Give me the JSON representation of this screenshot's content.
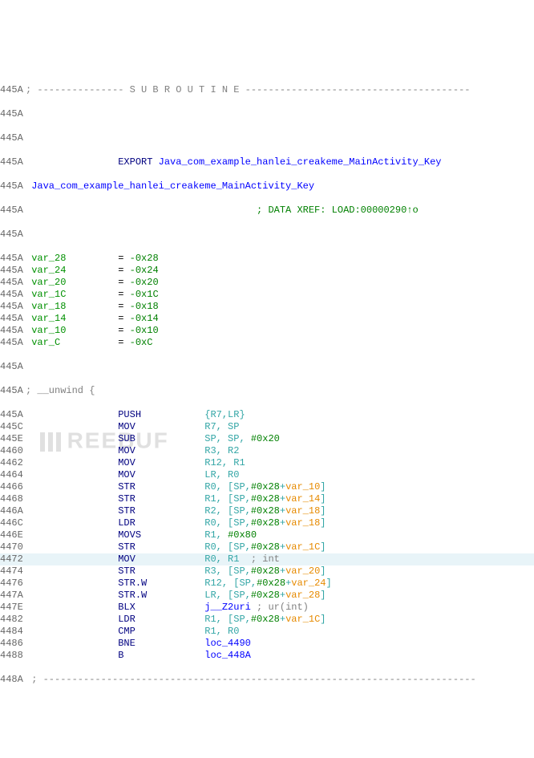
{
  "header": {
    "subroutine_banner": "; --------------- S U B R O U T I N E ---------------------------------------"
  },
  "export": {
    "keyword": "EXPORT",
    "symbol": "Java_com_example_hanlei_creakeme_MainActivity_Key"
  },
  "label": "Java_com_example_hanlei_creakeme_MainActivity_Key",
  "xref_comment": "; DATA XREF: LOAD:00000290↑o",
  "vars": [
    {
      "name": "var_28",
      "eq": "= ",
      "val": "-0x28"
    },
    {
      "name": "var_24",
      "eq": "= ",
      "val": "-0x24"
    },
    {
      "name": "var_20",
      "eq": "= ",
      "val": "-0x20"
    },
    {
      "name": "var_1C",
      "eq": "= ",
      "val": "-0x1C"
    },
    {
      "name": "var_18",
      "eq": "= ",
      "val": "-0x18"
    },
    {
      "name": "var_14",
      "eq": "= ",
      "val": "-0x14"
    },
    {
      "name": "var_10",
      "eq": "= ",
      "val": "-0x10"
    },
    {
      "name": "var_C",
      "eq": "= ",
      "val": "-0xC"
    }
  ],
  "unwind_comment": "; __unwind {",
  "instructions": [
    {
      "addr": "445A",
      "mnem": "PUSH",
      "ops": [
        {
          "t": "{R7,LR}",
          "c": "darkcyan"
        }
      ]
    },
    {
      "addr": "445C",
      "mnem": "MOV",
      "ops": [
        {
          "t": "R7, SP",
          "c": "darkcyan"
        }
      ]
    },
    {
      "addr": "445E",
      "mnem": "SUB",
      "ops": [
        {
          "t": "SP, SP, ",
          "c": "darkcyan"
        },
        {
          "t": "#0x20",
          "c": "green"
        }
      ]
    },
    {
      "addr": "4460",
      "mnem": "MOV",
      "ops": [
        {
          "t": "R3, R2",
          "c": "darkcyan"
        }
      ]
    },
    {
      "addr": "4462",
      "mnem": "MOV",
      "ops": [
        {
          "t": "R12, R1",
          "c": "darkcyan"
        }
      ]
    },
    {
      "addr": "4464",
      "mnem": "MOV",
      "ops": [
        {
          "t": "LR, R0",
          "c": "darkcyan"
        }
      ]
    },
    {
      "addr": "4466",
      "mnem": "STR",
      "ops": [
        {
          "t": "R0, [SP,",
          "c": "darkcyan"
        },
        {
          "t": "#0x28",
          "c": "green"
        },
        {
          "t": "+",
          "c": "darkcyan"
        },
        {
          "t": "var_10",
          "c": "orange"
        },
        {
          "t": "]",
          "c": "darkcyan"
        }
      ]
    },
    {
      "addr": "4468",
      "mnem": "STR",
      "ops": [
        {
          "t": "R1, [SP,",
          "c": "darkcyan"
        },
        {
          "t": "#0x28",
          "c": "green"
        },
        {
          "t": "+",
          "c": "darkcyan"
        },
        {
          "t": "var_14",
          "c": "orange"
        },
        {
          "t": "]",
          "c": "darkcyan"
        }
      ]
    },
    {
      "addr": "446A",
      "mnem": "STR",
      "ops": [
        {
          "t": "R2, [SP,",
          "c": "darkcyan"
        },
        {
          "t": "#0x28",
          "c": "green"
        },
        {
          "t": "+",
          "c": "darkcyan"
        },
        {
          "t": "var_18",
          "c": "orange"
        },
        {
          "t": "]",
          "c": "darkcyan"
        }
      ]
    },
    {
      "addr": "446C",
      "mnem": "LDR",
      "ops": [
        {
          "t": "R0, [SP,",
          "c": "darkcyan"
        },
        {
          "t": "#0x28",
          "c": "green"
        },
        {
          "t": "+",
          "c": "darkcyan"
        },
        {
          "t": "var_18",
          "c": "orange"
        },
        {
          "t": "]",
          "c": "darkcyan"
        }
      ]
    },
    {
      "addr": "446E",
      "mnem": "MOVS",
      "ops": [
        {
          "t": "R1, ",
          "c": "darkcyan"
        },
        {
          "t": "#0x80",
          "c": "green"
        }
      ]
    },
    {
      "addr": "4470",
      "mnem": "STR",
      "ops": [
        {
          "t": "R0, [SP,",
          "c": "darkcyan"
        },
        {
          "t": "#0x28",
          "c": "green"
        },
        {
          "t": "+",
          "c": "darkcyan"
        },
        {
          "t": "var_1C",
          "c": "orange"
        },
        {
          "t": "]",
          "c": "darkcyan"
        }
      ]
    },
    {
      "addr": "4472",
      "mnem": "MOV",
      "ops": [
        {
          "t": "R0, R1  ",
          "c": "darkcyan"
        },
        {
          "t": "; int",
          "c": "gray"
        }
      ],
      "hl": true
    },
    {
      "addr": "4474",
      "mnem": "STR",
      "ops": [
        {
          "t": "R3, [SP,",
          "c": "darkcyan"
        },
        {
          "t": "#0x28",
          "c": "green"
        },
        {
          "t": "+",
          "c": "darkcyan"
        },
        {
          "t": "var_20",
          "c": "orange"
        },
        {
          "t": "]",
          "c": "darkcyan"
        }
      ]
    },
    {
      "addr": "4476",
      "mnem": "STR.W",
      "ops": [
        {
          "t": "R12, [SP,",
          "c": "darkcyan"
        },
        {
          "t": "#0x28",
          "c": "green"
        },
        {
          "t": "+",
          "c": "darkcyan"
        },
        {
          "t": "var_24",
          "c": "orange"
        },
        {
          "t": "]",
          "c": "darkcyan"
        }
      ]
    },
    {
      "addr": "447A",
      "mnem": "STR.W",
      "ops": [
        {
          "t": "LR, [SP,",
          "c": "darkcyan"
        },
        {
          "t": "#0x28",
          "c": "green"
        },
        {
          "t": "+",
          "c": "darkcyan"
        },
        {
          "t": "var_28",
          "c": "orange"
        },
        {
          "t": "]",
          "c": "darkcyan"
        }
      ]
    },
    {
      "addr": "447E",
      "mnem": "BLX",
      "ops": [
        {
          "t": "j__Z2uri",
          "c": "blue"
        },
        {
          "t": " ; ur(int)",
          "c": "gray"
        }
      ]
    },
    {
      "addr": "4482",
      "mnem": "LDR",
      "ops": [
        {
          "t": "R1, [SP,",
          "c": "darkcyan"
        },
        {
          "t": "#0x28",
          "c": "green"
        },
        {
          "t": "+",
          "c": "darkcyan"
        },
        {
          "t": "var_1C",
          "c": "orange"
        },
        {
          "t": "]",
          "c": "darkcyan"
        }
      ]
    },
    {
      "addr": "4484",
      "mnem": "CMP",
      "ops": [
        {
          "t": "R1, R0",
          "c": "darkcyan"
        }
      ]
    },
    {
      "addr": "4486",
      "mnem": "BNE",
      "ops": [
        {
          "t": "loc_4490",
          "c": "blue"
        }
      ]
    },
    {
      "addr": "4488",
      "mnem": "B",
      "ops": [
        {
          "t": "loc_448A",
          "c": "blue"
        }
      ]
    }
  ],
  "footer_addr": "448A",
  "dash_line": " ; ---------------------------------------------------------------------------",
  "watermark": "REEBUF"
}
